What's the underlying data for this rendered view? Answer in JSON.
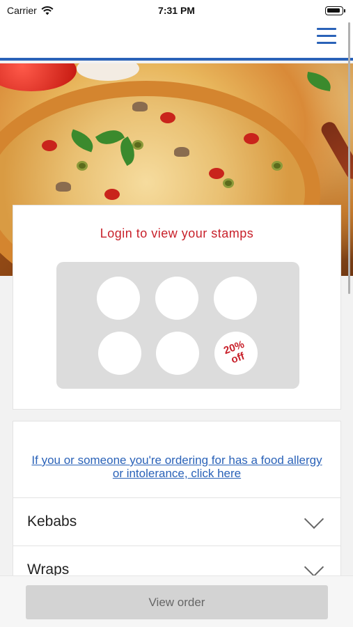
{
  "status_bar": {
    "carrier": "Carrier",
    "time": "7:31 PM",
    "icons": [
      "wifi-icon",
      "battery-icon"
    ]
  },
  "header": {
    "menu_icon": "hamburger-menu-icon",
    "accent_color": "#2a62b8"
  },
  "hero": {
    "image": "pizza-photo"
  },
  "loyalty": {
    "title": "Login to view your stamps",
    "stamp_count": 5,
    "reward_text_line1": "20%",
    "reward_text_line2": "off",
    "title_color": "#c8202a"
  },
  "menu": {
    "allergy_link": "If you or someone you're ordering for has a food allergy or intolerance, click here",
    "categories": [
      {
        "label": "Kebabs"
      },
      {
        "label": "Wraps"
      }
    ]
  },
  "bottom": {
    "view_order_label": "View order"
  }
}
